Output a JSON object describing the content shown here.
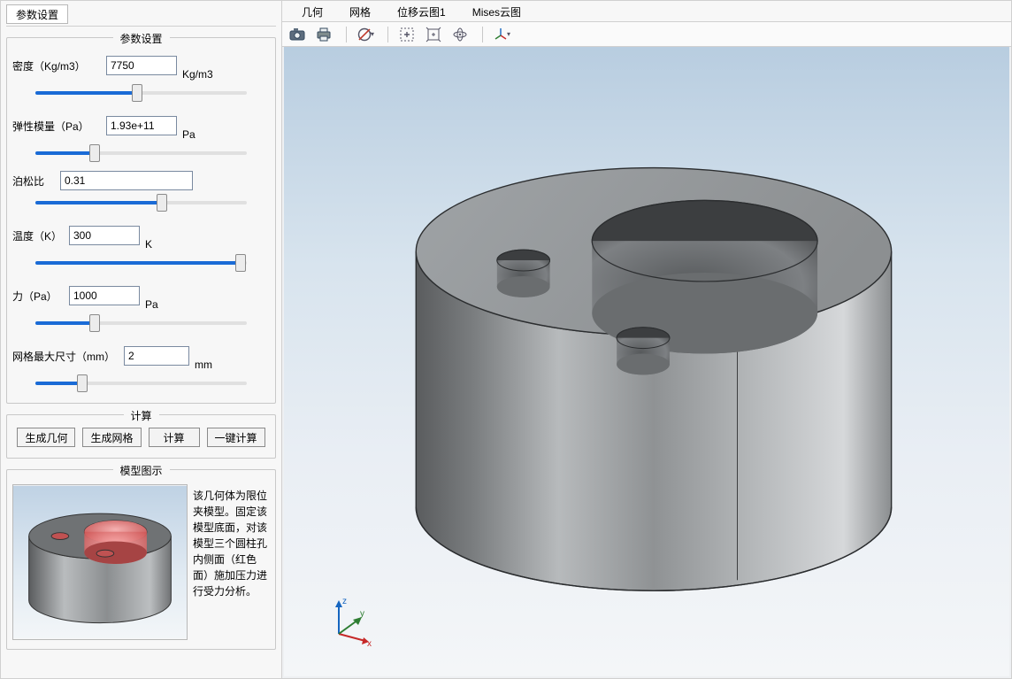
{
  "leftTab": "参数设置",
  "group_params_title": "参数设置",
  "group_compute_title": "计算",
  "group_model_title": "模型图示",
  "params": {
    "density": {
      "label": "密度（Kg/m3）",
      "value": "7750",
      "unit": "Kg/m3",
      "slider_pct": 48
    },
    "modulus": {
      "label": "弹性模量（Pa）",
      "value": "1.93e+11",
      "unit": "Pa",
      "slider_pct": 28
    },
    "poisson": {
      "label": "泊松比",
      "value": "0.31",
      "unit": "",
      "slider_pct": 60
    },
    "temperature": {
      "label": "温度（K）",
      "value": "300",
      "unit": "K",
      "slider_pct": 97
    },
    "force": {
      "label": "力（Pa）",
      "value": "1000",
      "unit": "Pa",
      "slider_pct": 28
    },
    "mesh": {
      "label": "网格最大尺寸（mm）",
      "value": "2",
      "unit": "mm",
      "slider_pct": 22
    }
  },
  "buttons": {
    "geom": "生成几何",
    "mesh": "生成网格",
    "calc": "计算",
    "one_click": "一键计算"
  },
  "model_description": "该几何体为限位夹模型。固定该模型底面，对该模型三个圆柱孔内侧面（红色面）施加压力进行受力分析。",
  "view_tabs": {
    "geometry": "几何",
    "mesh": "网格",
    "disp": "位移云图1",
    "mises": "Mises云图"
  },
  "toolbar_names": {
    "camera": "camera-icon",
    "print": "print-icon",
    "reset": "reset-view-icon",
    "zoom_box": "zoom-box-icon",
    "zoom_extent": "zoom-extent-icon",
    "rotate": "rotate-icon",
    "axes": "axes-toggle-icon"
  },
  "triad": {
    "x": "x",
    "y": "y",
    "z": "z"
  }
}
